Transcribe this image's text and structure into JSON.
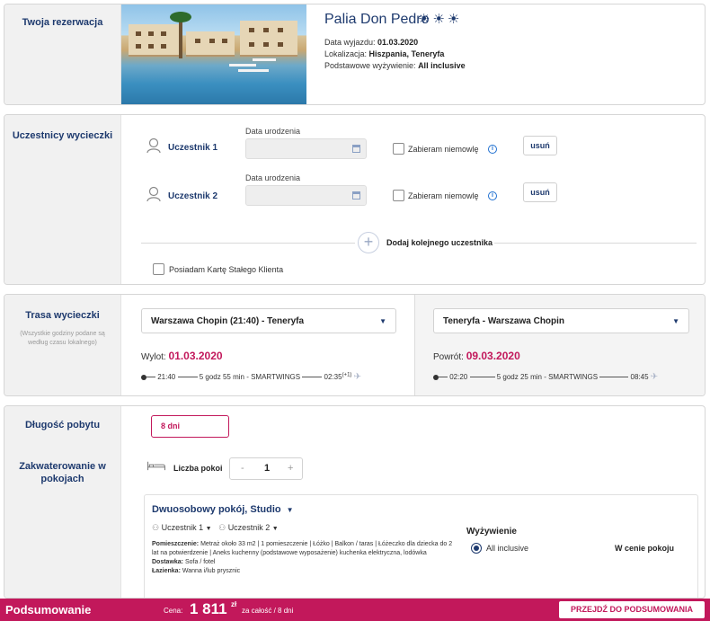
{
  "reservation": {
    "side_title": "Twoja rezerwacja",
    "hotel_name": "Palia Don Pedro",
    "stars": "☀☀☀",
    "departure_label": "Data wyjazdu:",
    "departure_value": "01.03.2020",
    "location_label": "Lokalizacja:",
    "location_value": "Hiszpania, Teneryfa",
    "board_label": "Podstawowe wyżywienie:",
    "board_value": "All inclusive"
  },
  "participants": {
    "side_title": "Uczestnicy wycieczki",
    "dob_label": "Data urodzenia",
    "infant_label": "Zabieram niemowlę",
    "remove_label": "usuń",
    "items": [
      {
        "label": "Uczestnik 1",
        "dob": ""
      },
      {
        "label": "Uczestnik 2",
        "dob": ""
      }
    ],
    "add_label": "Dodaj kolejnego uczestnika",
    "card_label": "Posiadam Kartę Stałego Klienta"
  },
  "route": {
    "side_title": "Trasa wycieczki",
    "side_note": "(Wszystkie godziny podane są według czasu lokalnego)",
    "outbound": {
      "select": "Warszawa Chopin (21:40) - Teneryfa",
      "date_label": "Wylot:",
      "date": "01.03.2020",
      "dep_time": "21:40",
      "duration": "5 godz 55 min - SMARTWINGS",
      "arr_time": "02:35",
      "arr_suffix": "(+1)"
    },
    "return": {
      "select": "Teneryfa - Warszawa Chopin",
      "date_label": "Powrót:",
      "date": "09.03.2020",
      "dep_time": "02:20",
      "duration": "5 godz 25 min - SMARTWINGS",
      "arr_time": "08:45"
    }
  },
  "stay": {
    "side_title_length": "Długość pobytu",
    "days": "8 dni",
    "side_title_rooms": "Zakwaterowanie w pokojach",
    "rooms_label": "Liczba pokoi",
    "rooms_minus": "-",
    "rooms_value": "1",
    "rooms_plus": "+",
    "room": {
      "title": "Dwuosobowy pokój, Studio",
      "person1": "Uczestnik 1",
      "person2": "Uczestnik 2",
      "desc_label1": "Pomieszczenie:",
      "desc_text1": "Metraż około 33 m2 | 1 pomieszczenie | Łóżko | Balkon / taras | Łóżeczko dla dziecka do 2 lat na potwierdzenie | Aneks kuchenny (podstawowe wyposażenie) kuchenka elektryczna, lodówka",
      "desc_label2": "Dostawka:",
      "desc_text2": "Sofa / fotel",
      "desc_label3": "Łazienka:",
      "desc_text3": "Wanna i/lub prysznic",
      "board_title": "Wyżywienie",
      "board_option": "All inclusive",
      "board_price": "W cenie pokoju"
    }
  },
  "footer": {
    "title": "Podsumowanie",
    "price_label": "Cena:",
    "price": "1 811",
    "currency": "zł",
    "price_note": "za całość / 8 dni",
    "button": "PRZEJDŹ DO PODSUMOWANIA"
  },
  "colors": {
    "navy": "#1e3a6e",
    "accent": "#c2185b"
  }
}
